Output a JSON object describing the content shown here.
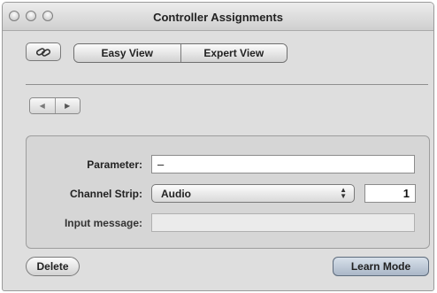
{
  "window": {
    "title": "Controller Assignments"
  },
  "toolbar": {
    "link_icon": "link-icon",
    "view_tabs": [
      {
        "label": "Easy View",
        "selected": false
      },
      {
        "label": "Expert View",
        "selected": false
      }
    ]
  },
  "navigation": {
    "back_icon": "triangle-left-icon",
    "forward_icon": "triangle-right-icon"
  },
  "form": {
    "parameter_label": "Parameter:",
    "parameter_value": "–",
    "channel_strip_label": "Channel Strip:",
    "channel_strip_value": "Audio",
    "channel_number": "1",
    "input_message_label": "Input message:",
    "input_message_value": ""
  },
  "footer": {
    "delete_label": "Delete",
    "learn_mode_label": "Learn Mode"
  }
}
